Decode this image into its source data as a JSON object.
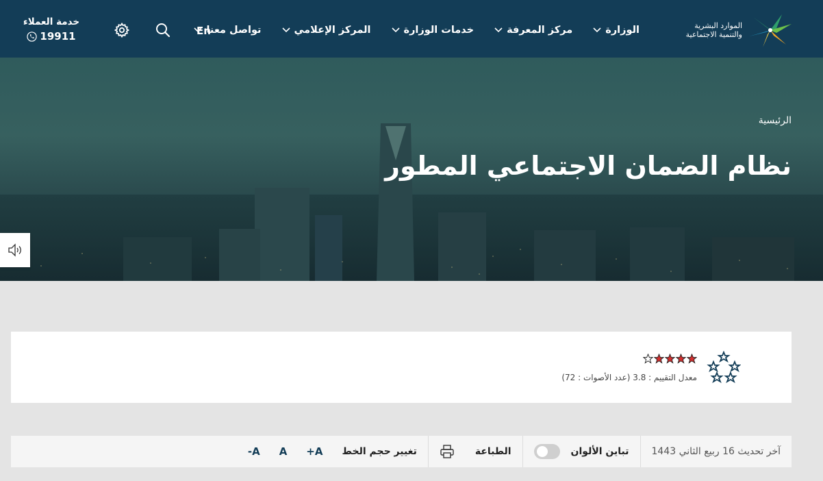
{
  "header": {
    "logo": {
      "line1": "الموارد البشرية",
      "line2": "والتنمية الاجتماعية"
    },
    "nav": [
      {
        "label": "الوزارة",
        "has_dropdown": true
      },
      {
        "label": "مركز المعرفة",
        "has_dropdown": true
      },
      {
        "label": "خدمات الوزارة",
        "has_dropdown": true
      },
      {
        "label": "المركز الإعلامي",
        "has_dropdown": true
      },
      {
        "label": "تواصل معنا",
        "has_dropdown": true
      }
    ],
    "lang_label": "En",
    "search_icon": "search-icon",
    "settings_icon": "gear-icon",
    "customer_service": {
      "title": "خدمة العملاء",
      "phone": "19911"
    }
  },
  "hero": {
    "breadcrumb": "الرئيسية",
    "title": "نظام الضمان الاجتماعي المطور"
  },
  "rating": {
    "rating_value": 3.8,
    "stars_filled": 4,
    "stars_total": 5,
    "text": "معدل التقييم : 3.8 (عدد الأصوات : 72)",
    "star_color": "#d32f2f"
  },
  "tools": {
    "last_updated": "آخر تحديث 16 ربيع الثاني 1443",
    "contrast_label": "تباين الألوان",
    "print_label": "الطباعة",
    "font_size_label": "تغيير حجم الخط",
    "font_increase": "+A",
    "font_reset": "A",
    "font_decrease": "-A"
  },
  "colors": {
    "header_bg": "#133d57",
    "accent_green": "#2e9e6b",
    "accent_orange": "#f5a623"
  }
}
